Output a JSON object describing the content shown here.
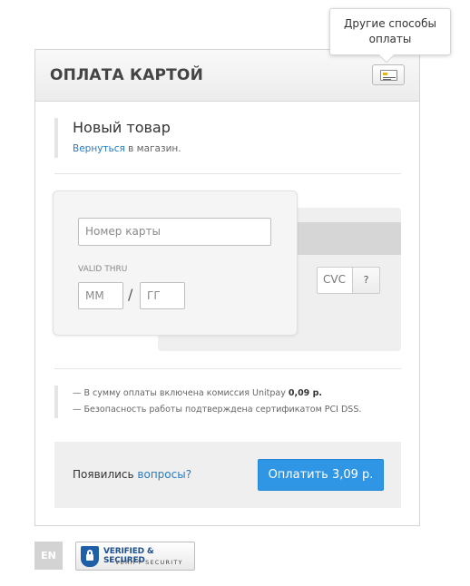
{
  "tooltip": {
    "text": "Другие способы оплаты"
  },
  "header": {
    "title": "ОПЛАТА КАРТОЙ",
    "methods_icon": "card-icon"
  },
  "product": {
    "name": "Новый товар",
    "back_link": "Вернуться",
    "back_suffix": " в магазин."
  },
  "card": {
    "number_placeholder": "Номер карты",
    "valid_thru_label": "VALID THRU",
    "month_placeholder": "ММ",
    "separator": "/",
    "year_placeholder": "ГГ",
    "cvc_placeholder": "CVC",
    "cvc_help": "?"
  },
  "notes": {
    "commission_prefix": "— В сумму оплаты включена комиссия Unitpay ",
    "commission_amount": "0,09 р.",
    "security": "— Безопасность работы подтверждена сертификатом PCI DSS."
  },
  "footer": {
    "question_prefix": "Появились ",
    "question_link": "вопросы?",
    "pay_button": "Оплатить 3,09 р."
  },
  "bottom": {
    "language": "EN",
    "badge_title": "VERIFIED & SECURED",
    "badge_sub": "VERIFY SECURITY"
  },
  "colors": {
    "accent": "#2f96e5",
    "link": "#2a7ac0"
  }
}
